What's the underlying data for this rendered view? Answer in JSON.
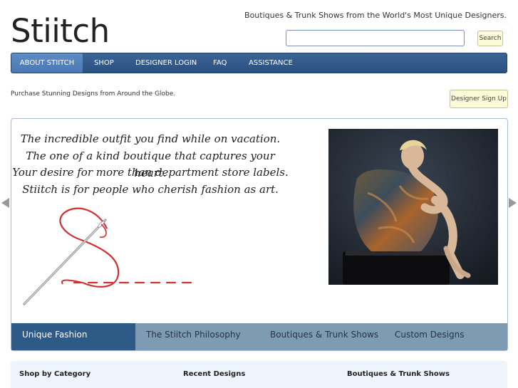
{
  "header": {
    "logo": "Stiitch",
    "tagline": "Boutiques & Trunk Shows from the World's Most Unique Designers.",
    "search_placeholder": "",
    "search_button": "Search"
  },
  "nav": {
    "items": [
      {
        "label": "ABOUT STIITCH",
        "active": true
      },
      {
        "label": "SHOP",
        "active": false
      },
      {
        "label": "DESIGNER LOGIN",
        "active": false
      },
      {
        "label": "FAQ",
        "active": false
      },
      {
        "label": "ASSISTANCE",
        "active": false
      }
    ]
  },
  "intro": {
    "text": "Purchase Stunning Designs from Around the Globe.",
    "signup_button": "Designer Sign Up"
  },
  "slider": {
    "quote_lines": [
      "The incredible outfit you find while on vacation.",
      "The one of a kind boutique that captures your heart.",
      "Your desire for more than department store labels.",
      "Stiitch is for people who cherish fashion as art."
    ],
    "tabs": [
      {
        "label": "Unique Fashion",
        "active": true
      },
      {
        "label": "The Stiitch Philosophy",
        "active": false
      },
      {
        "label": "Boutiques & Trunk Shows",
        "active": false
      },
      {
        "label": "Custom Designs",
        "active": false
      }
    ]
  },
  "bottom": {
    "headings": [
      "Shop by Category",
      "Recent Designs",
      "Boutiques & Trunk Shows"
    ]
  },
  "colors": {
    "nav": "#2b5080",
    "nav_active": "#4a78b3",
    "tab_bar": "#7e9bb4",
    "tab_active": "#2e5a87",
    "button_bg": "#fdfbd7",
    "thread": "#d03030"
  }
}
